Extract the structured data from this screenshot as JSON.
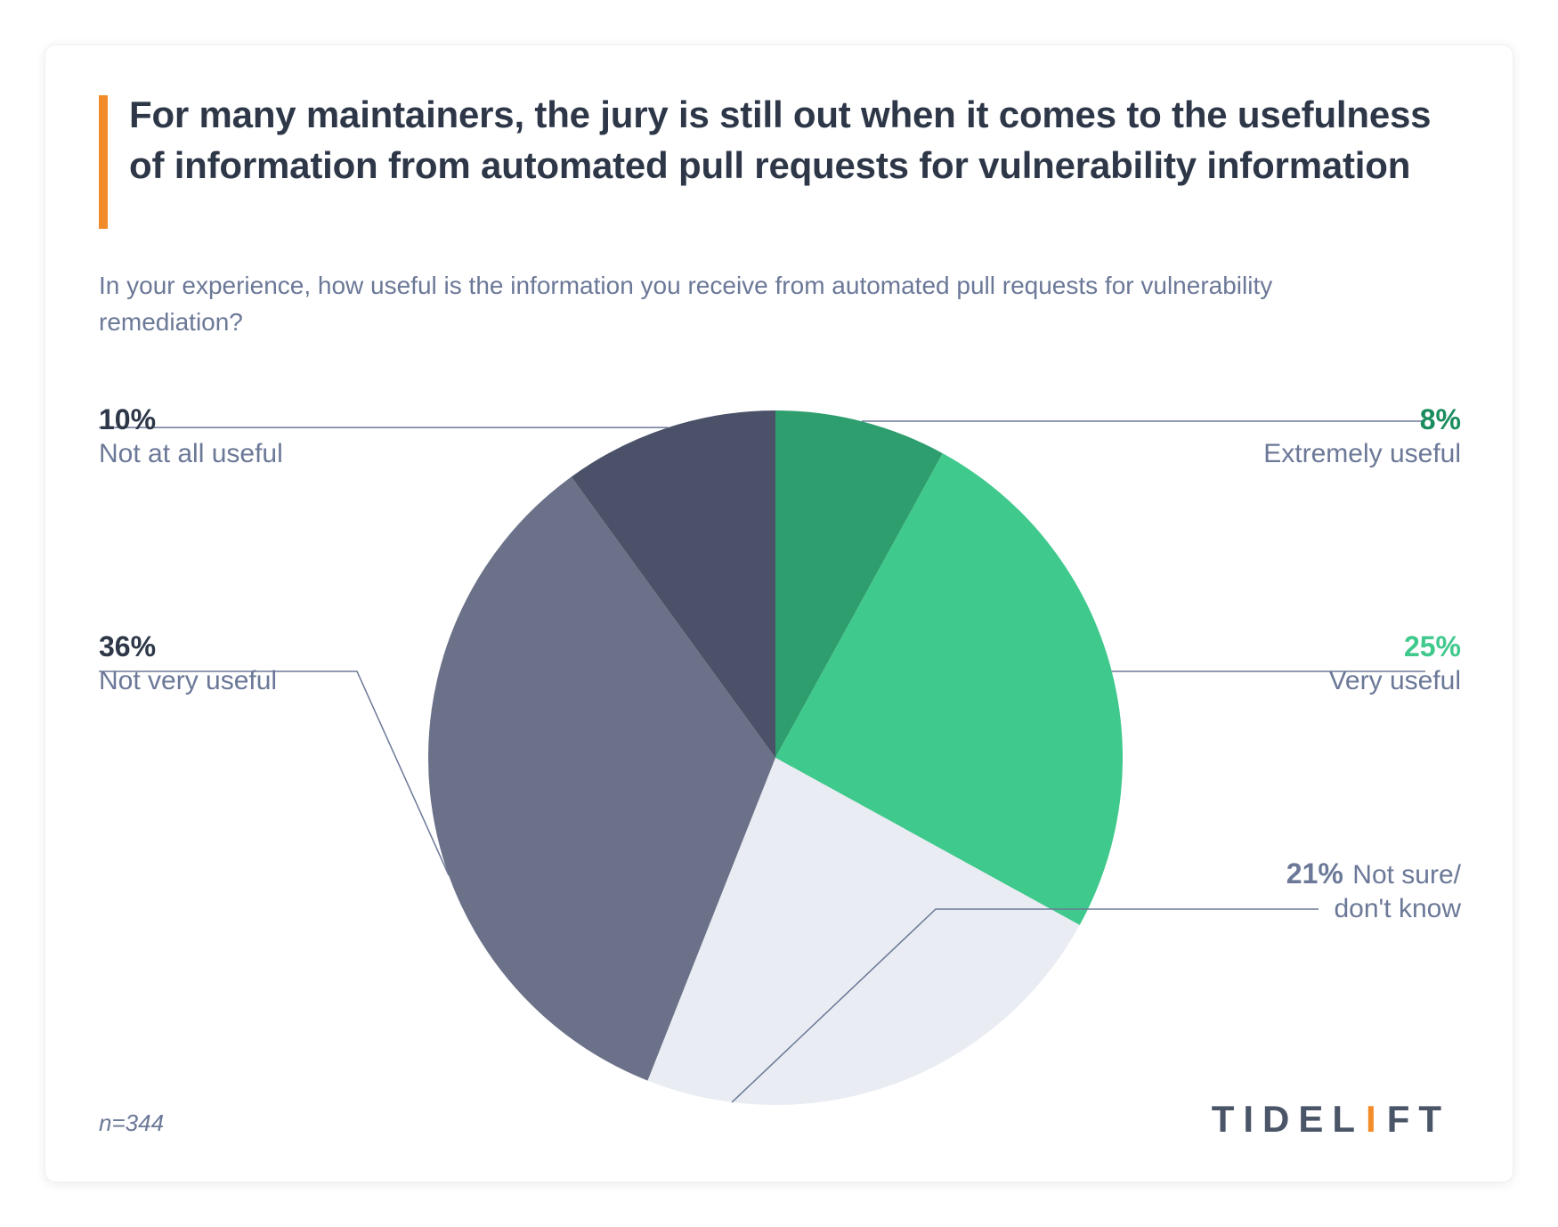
{
  "title": "For many maintainers, the jury is still out when it comes to the usefulness of information from automated pull requests for vulnerability information",
  "subtitle": "In your experience, how useful is the information you receive from automated pull requests for vulnerability remediation?",
  "n_note": "n=344",
  "brand": "TIDELIFT",
  "labels": {
    "extreme": {
      "pct": "8%",
      "desc": "Extremely useful"
    },
    "very": {
      "pct": "25%",
      "desc": "Very useful"
    },
    "notsure_pct": "21%",
    "notsure_l1": "Not sure/",
    "notsure_l2": "don't know",
    "notvery": {
      "pct": "36%",
      "desc": "Not very useful"
    },
    "notat": {
      "pct": "10%",
      "desc": "Not at all useful"
    }
  },
  "chart_data": {
    "type": "pie",
    "title": "Usefulness of information from automated pull requests for vulnerability remediation",
    "n": 344,
    "series": [
      {
        "name": "Extremely useful",
        "value": 8,
        "color": "#2f9e6e"
      },
      {
        "name": "Very useful",
        "value": 25,
        "color": "#40c98d"
      },
      {
        "name": "Not sure/don't know",
        "value": 21,
        "color": "#e9ecf2"
      },
      {
        "name": "Not very useful",
        "value": 36,
        "color": "#6b7188"
      },
      {
        "name": "Not at all useful",
        "value": 10,
        "color": "#4a5168"
      }
    ]
  }
}
